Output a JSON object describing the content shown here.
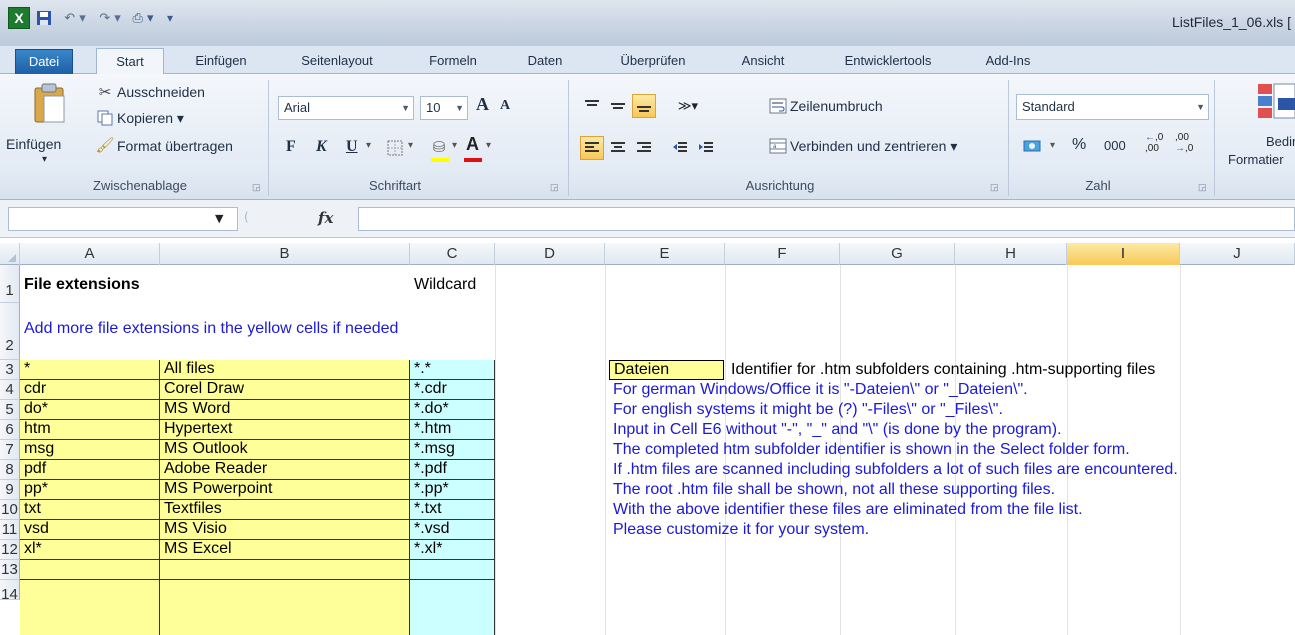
{
  "window": {
    "title": "ListFiles_1_06.xls  [",
    "app_logo": "X"
  },
  "quick_access": {
    "icons": [
      "excel-logo-icon",
      "save-icon",
      "undo-icon",
      "redo-icon",
      "print-icon",
      "customize-icon"
    ]
  },
  "tabs": [
    "Datei",
    "Start",
    "Einfügen",
    "Seitenlayout",
    "Formeln",
    "Daten",
    "Überprüfen",
    "Ansicht",
    "Entwicklertools",
    "Add-Ins"
  ],
  "ribbon": {
    "clipboard": {
      "paste": "Einfügen",
      "cut": "Ausschneiden",
      "copy": "Kopieren ▾",
      "format_painter": "Format übertragen",
      "label": "Zwischenablage"
    },
    "font": {
      "font_name": "Arial",
      "font_size": "10",
      "grow": "A",
      "shrink": "A",
      "bold": "F",
      "italic": "K",
      "underline": "U",
      "label": "Schriftart"
    },
    "alignment": {
      "wrap": "Zeilenumbruch",
      "merge": "Verbinden und zentrieren ▾",
      "label": "Ausrichtung"
    },
    "number": {
      "format": "Standard",
      "percent": "%",
      "thousands": "000",
      "inc_decimal": ",0",
      "dec_decimal": ",00",
      "label": "Zahl"
    },
    "styles": {
      "conditional_line1": "Beding",
      "conditional_line2": "Formatier"
    }
  },
  "formula_bar": {
    "name_box": "",
    "fx": "fx",
    "formula": ""
  },
  "columns": [
    "A",
    "B",
    "C",
    "D",
    "E",
    "F",
    "G",
    "H",
    "I",
    "J"
  ],
  "selected_column": "I",
  "rows": [
    "1",
    "2",
    "3",
    "4",
    "5",
    "6",
    "7",
    "8",
    "9",
    "10",
    "11",
    "12",
    "13",
    "14"
  ],
  "sheet": {
    "a1": "File extensions",
    "c1": "Wildcard",
    "a2": "Add more file extensions in the yellow cells if needed",
    "extensions": [
      {
        "ext": "*",
        "name": "All files",
        "wildcard": "*.*"
      },
      {
        "ext": "cdr",
        "name": "Corel Draw",
        "wildcard": "*.cdr"
      },
      {
        "ext": "do*",
        "name": "MS Word",
        "wildcard": "*.do*"
      },
      {
        "ext": "htm",
        "name": "Hypertext",
        "wildcard": "*.htm"
      },
      {
        "ext": "msg",
        "name": "MS Outlook",
        "wildcard": "*.msg"
      },
      {
        "ext": "pdf",
        "name": "Adobe Reader",
        "wildcard": "*.pdf"
      },
      {
        "ext": "pp*",
        "name": "MS Powerpoint",
        "wildcard": "*.pp*"
      },
      {
        "ext": "txt",
        "name": "Textfiles",
        "wildcard": "*.txt"
      },
      {
        "ext": "vsd",
        "name": "MS Visio",
        "wildcard": "*.vsd"
      },
      {
        "ext": "xl*",
        "name": "MS Excel",
        "wildcard": "*.xl*"
      }
    ],
    "e3": "Dateien",
    "f3": "Identifier for .htm subfolders containing .htm-supporting files",
    "notes": [
      "For german Windows/Office it is \"-Dateien\\\" or \"_Dateien\\\".",
      "For english systems it might be (?) \"-Files\\\" or \"_Files\\\".",
      "Input in Cell E6 without \"-\", \"_\" and \"\\\" (is done by the program).",
      "The completed htm subfolder identifier is shown in the Select folder form.",
      "If .htm files are scanned including subfolders a lot of such files are encountered.",
      "The root .htm file shall be shown, not all these supporting files.",
      "With the above identifier these files are eliminated from the file list.",
      "Please customize it for your system."
    ]
  },
  "colors": {
    "yellow_cell": "#ffff99",
    "cyan_cell": "#ccffff",
    "note_text": "#1a1ad8",
    "selection": "#f7c957"
  }
}
